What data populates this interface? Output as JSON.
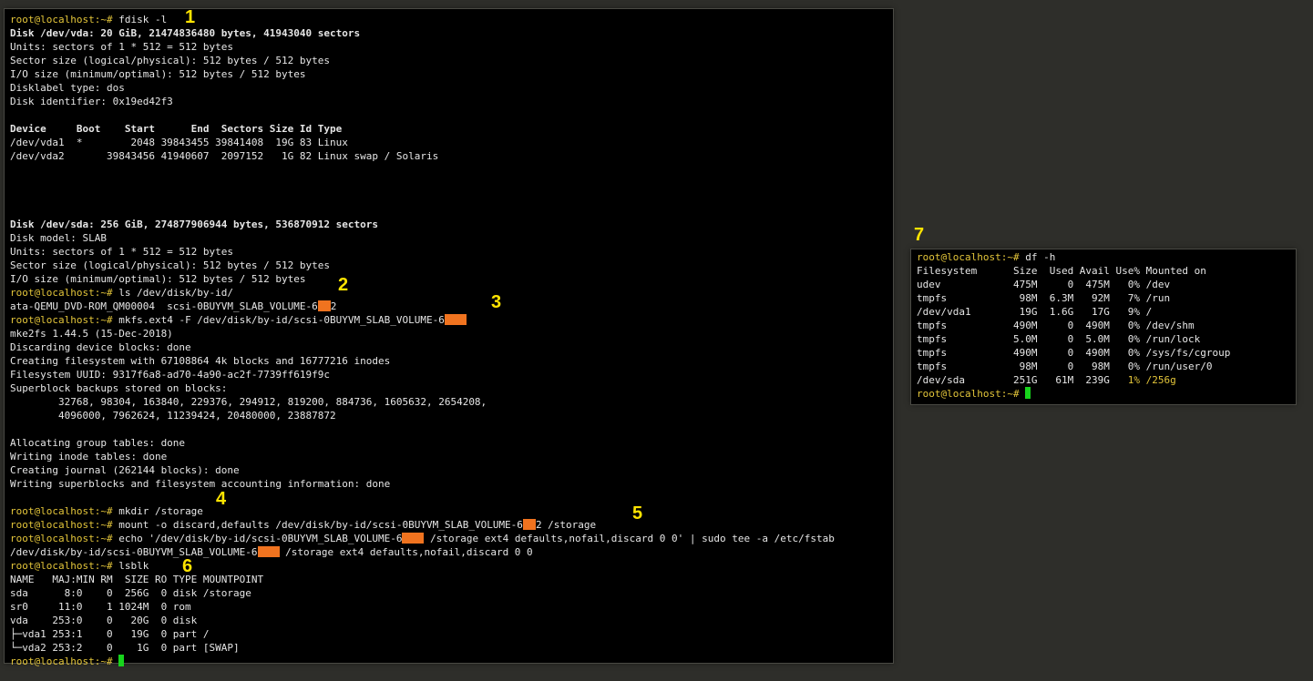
{
  "main_terminal": {
    "prompt": "root@localhost:~#",
    "cmd1": " fdisk -l",
    "vda_header": "Disk /dev/vda: 20 GiB, 21474836480 bytes, 41943040 sectors",
    "vda_units": "Units: sectors of 1 * 512 = 512 bytes",
    "vda_sector": "Sector size (logical/physical): 512 bytes / 512 bytes",
    "vda_io": "I/O size (minimum/optimal): 512 bytes / 512 bytes",
    "vda_label": "Disklabel type: dos",
    "vda_ident": "Disk identifier: 0x19ed42f3",
    "part_header": "Device     Boot    Start      End  Sectors Size Id Type",
    "part_rows": [
      "/dev/vda1  *        2048 39843455 39841408  19G 83 Linux",
      "/dev/vda2       39843456 41940607  2097152   1G 82 Linux swap / Solaris"
    ],
    "sda_header": "Disk /dev/sda: 256 GiB, 274877906944 bytes, 536870912 sectors",
    "sda_model": "Disk model: SLAB",
    "sda_units": "Units: sectors of 1 * 512 = 512 bytes",
    "sda_sector": "Sector size (logical/physical): 512 bytes / 512 bytes",
    "sda_io": "I/O size (minimum/optimal): 512 bytes / 512 bytes",
    "cmd2": " ls /dev/disk/by-id/",
    "ls_out_a": "ata-QEMU_DVD-ROM_QM00004  scsi-0BUYVM_SLAB_VOLUME-6",
    "ls_out_b": "2",
    "cmd3": " mkfs.ext4 -F /dev/disk/by-id/scsi-0BUYVM_SLAB_VOLUME-6",
    "mkfs_out": [
      "mke2fs 1.44.5 (15-Dec-2018)",
      "Discarding device blocks: done",
      "Creating filesystem with 67108864 4k blocks and 16777216 inodes",
      "Filesystem UUID: 9317f6a8-ad70-4a90-ac2f-7739ff619f9c",
      "Superblock backups stored on blocks:",
      "        32768, 98304, 163840, 229376, 294912, 819200, 884736, 1605632, 2654208,",
      "        4096000, 7962624, 11239424, 20480000, 23887872"
    ],
    "mkfs_out2": [
      "Allocating group tables: done",
      "Writing inode tables: done",
      "Creating journal (262144 blocks): done",
      "Writing superblocks and filesystem accounting information: done"
    ],
    "cmd4": " mkdir /storage",
    "cmd5a": " mount -o discard,defaults /dev/disk/by-id/scsi-0BUYVM_SLAB_VOLUME-6",
    "cmd5b": "2 /storage",
    "cmd_echo_a": " echo '/dev/disk/by-id/scsi-0BUYVM_SLAB_VOLUME-6",
    "cmd_echo_b": " /storage ext4 defaults,nofail,discard 0 0' | sudo tee -a /etc/fstab",
    "tee_out_a": "/dev/disk/by-id/scsi-0BUYVM_SLAB_VOLUME-6",
    "tee_out_b": " /storage ext4 defaults,nofail,discard 0 0",
    "cmd6": " lsblk",
    "lsblk_rows": [
      "NAME   MAJ:MIN RM  SIZE RO TYPE MOUNTPOINT",
      "sda      8:0    0  256G  0 disk /storage",
      "sr0     11:0    1 1024M  0 rom",
      "vda    253:0    0   20G  0 disk",
      "├─vda1 253:1    0   19G  0 part /",
      "└─vda2 253:2    0    1G  0 part [SWAP]"
    ]
  },
  "df_terminal": {
    "prompt": "root@localhost:~#",
    "cmd": " df -h",
    "header": "Filesystem      Size  Used Avail Use% Mounted on",
    "rows": [
      "udev            475M     0  475M   0% /dev",
      "tmpfs            98M  6.3M   92M   7% /run",
      "/dev/vda1        19G  1.6G   17G   9% /",
      "tmpfs           490M     0  490M   0% /dev/shm",
      "tmpfs           5.0M     0  5.0M   0% /run/lock",
      "tmpfs           490M     0  490M   0% /sys/fs/cgroup",
      "tmpfs            98M     0   98M   0% /run/user/0"
    ],
    "sda_row_a": "/dev/sda        251G   61M  239G   ",
    "sda_row_b": "1% /256g"
  },
  "step_labels": [
    "1",
    "2",
    "3",
    "4",
    "5",
    "6",
    "7"
  ],
  "colors": {
    "prompt": "#e3c53a",
    "redaction": "#f0731f",
    "cursor": "#17d41c",
    "step_label": "#ffe400"
  }
}
